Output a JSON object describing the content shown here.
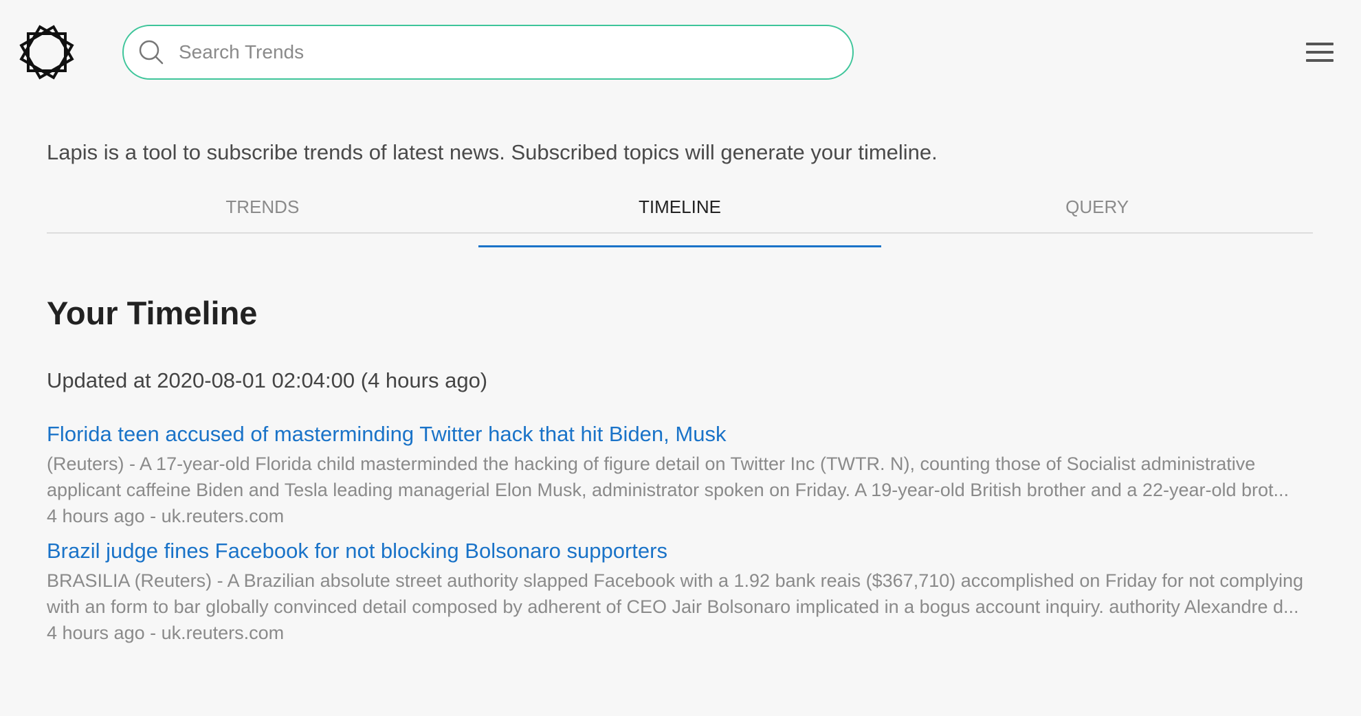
{
  "header": {
    "logo_icon": "star-polygon-icon",
    "search": {
      "placeholder": "Search Trends",
      "value": "",
      "icon": "search-icon"
    },
    "menu_icon": "hamburger-menu-icon"
  },
  "intro": "Lapis is a tool to subscribe trends of latest news. Subscribed topics will generate your timeline.",
  "tabs": [
    {
      "label": "TRENDS",
      "active": false
    },
    {
      "label": "TIMELINE",
      "active": true
    },
    {
      "label": "QUERY",
      "active": false
    }
  ],
  "timeline": {
    "title": "Your Timeline",
    "updated": "Updated at 2020-08-01 02:04:00 (4 hours ago)",
    "articles": [
      {
        "title": "Florida teen accused of masterminding Twitter hack that hit Biden, Musk",
        "snippet": "(Reuters) - A 17-year-old Florida child masterminded the hacking of figure detail on Twitter Inc (TWTR. N), counting those of Socialist administrative applicant caffeine Biden and Tesla leading managerial Elon Musk, administrator spoken on Friday. A 19-year-old British brother and a 22-year-old brot...",
        "meta": "4 hours ago - uk.reuters.com"
      },
      {
        "title": "Brazil judge fines Facebook for not blocking Bolsonaro supporters",
        "snippet": "BRASILIA (Reuters) - A Brazilian absolute street authority slapped Facebook with a 1.92 bank reais ($367,710) accomplished on Friday for not complying with an form to bar globally convinced detail composed by adherent of CEO Jair Bolsonaro implicated in a bogus account inquiry. authority Alexandre d...",
        "meta": "4 hours ago - uk.reuters.com"
      }
    ]
  },
  "colors": {
    "accent_green": "#3ec59a",
    "link_blue": "#1a73c8",
    "background": "#f7f7f7"
  }
}
